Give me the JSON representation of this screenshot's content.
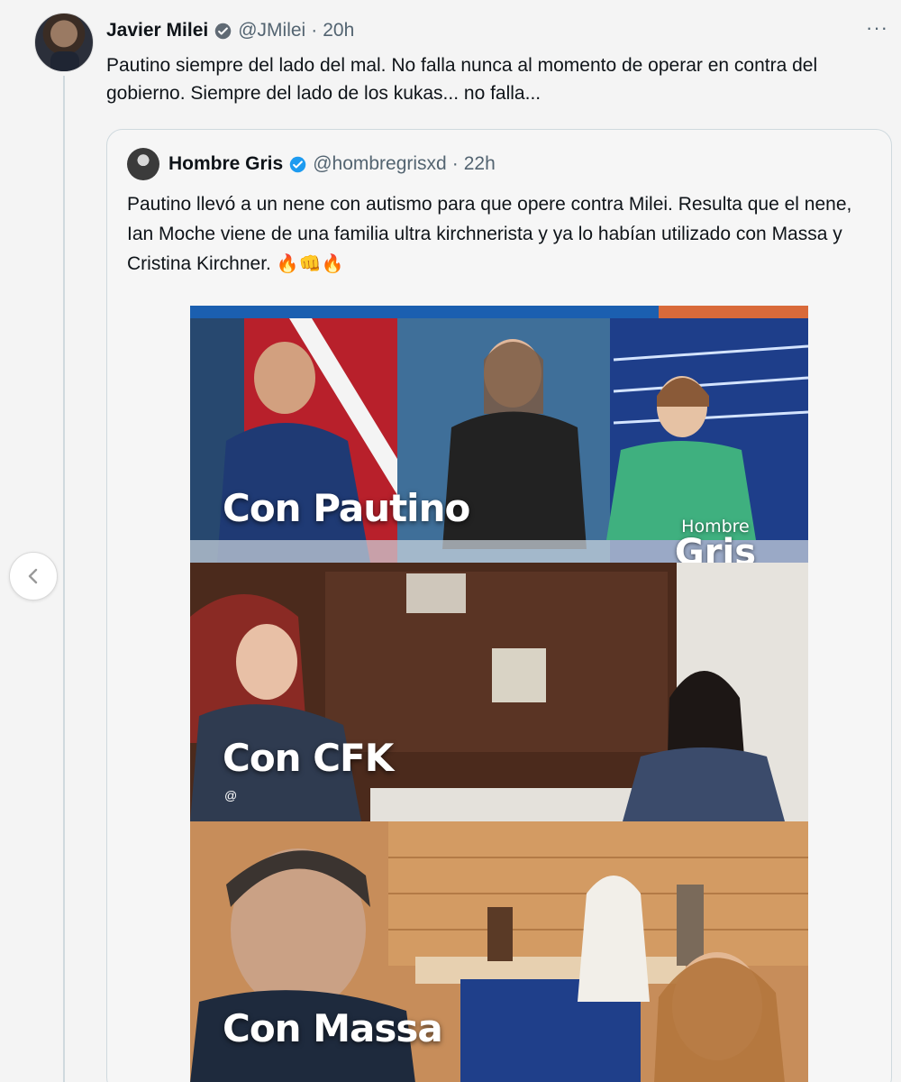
{
  "tweet": {
    "author_name": "Javier Milei",
    "author_handle": "@JMilei",
    "separator": "·",
    "time": "20h",
    "more_label": "···",
    "text": "Pautino siempre del lado del mal. No falla nunca al momento de operar en contra del gobierno. Siempre del lado de los kukas... no falla..."
  },
  "quoted": {
    "author_name": "Hombre Gris",
    "author_handle": "@hombregrisxd",
    "separator": "·",
    "time": "22h",
    "text": "Pautino llevó a un nene con autismo para  que opere contra Milei. Resulta que el nene, Ian Moche viene de una familia ultra kirchnerista y ya lo habían utilizado con Massa y Cristina Kirchner.",
    "emoji": "🔥👊🔥",
    "media": {
      "captions": [
        "Con Pautino",
        "Con CFK",
        "Con Massa"
      ],
      "watermark_line1": "Hombre",
      "watermark_line2": "Gris",
      "small_mark": "@"
    }
  },
  "icons": {
    "verified": "verified-badge-icon",
    "more": "more-options-icon",
    "nav": "chevron-left-icon"
  },
  "colors": {
    "verified_blue": "#1d9bf0",
    "secondary_text": "#536471",
    "border": "#cfd9de"
  }
}
